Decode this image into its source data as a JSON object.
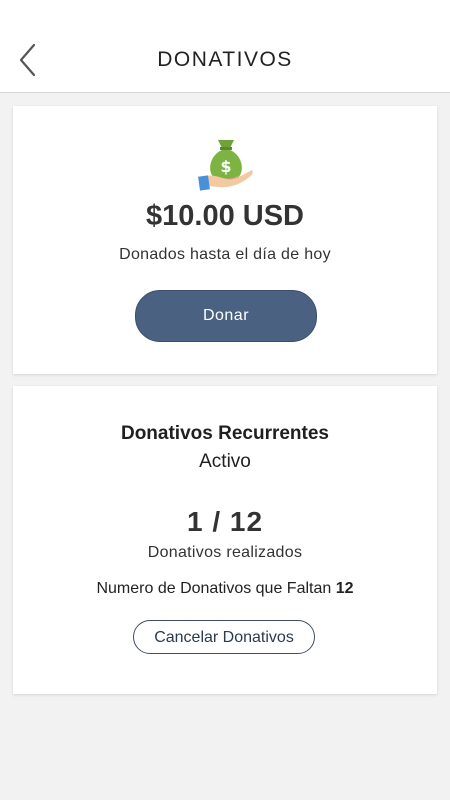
{
  "header": {
    "title": "DONATIVOS",
    "back_icon": "chevron-left-icon"
  },
  "total_card": {
    "icon": "money-bag-hand-icon",
    "amount": "$10.00 USD",
    "caption": "Donados hasta el día de hoy",
    "donate_label": "Donar"
  },
  "recurring_card": {
    "title": "Donativos Recurrentes",
    "status": "Activo",
    "count": "1 / 12",
    "count_caption": "Donativos realizados",
    "remaining_label": "Numero de Donativos que Faltan",
    "remaining_value": "12",
    "cancel_label": "Cancelar Donativos"
  },
  "colors": {
    "primary_button": "#4b6182",
    "background": "#f3f2f2",
    "money_green": "#7cb342",
    "hand_skin": "#f3c9a1",
    "cuff_blue": "#4a90d9"
  }
}
